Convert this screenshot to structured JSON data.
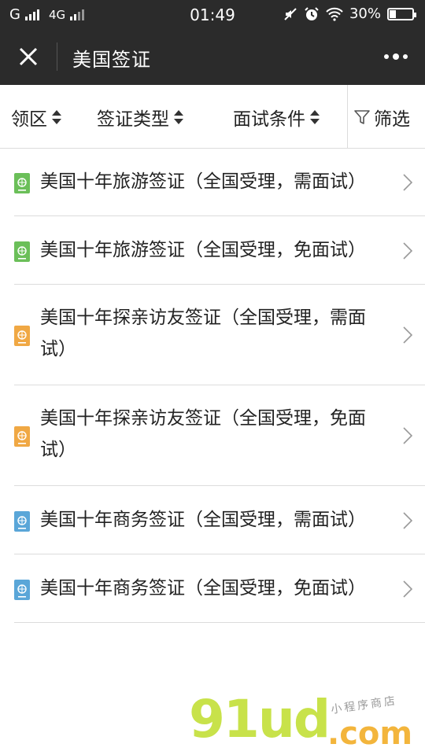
{
  "status_bar": {
    "carrier_left": "G",
    "network": "4G",
    "time": "01:49",
    "battery": "30%",
    "battery_level": 0.3
  },
  "navbar": {
    "title": "美国签证"
  },
  "filters": [
    {
      "label": "领区"
    },
    {
      "label": "签证类型"
    },
    {
      "label": "面试条件"
    },
    {
      "label": "筛选"
    }
  ],
  "items": [
    {
      "line1": "美国十年旅游签证（全国受理，需面试）",
      "line2": "",
      "icon_color": "#6bbf59"
    },
    {
      "line1": "美国十年旅游签证（全国受理，免面试）",
      "line2": "",
      "icon_color": "#6bbf59"
    },
    {
      "line1": "美国十年探亲访友签证（全国受理，需面",
      "line2": "试）",
      "icon_color": "#f0a844"
    },
    {
      "line1": "美国十年探亲访友签证（全国受理，免面",
      "line2": "试）",
      "icon_color": "#f0a844"
    },
    {
      "line1": "美国十年商务签证（全国受理，需面试）",
      "line2": "",
      "icon_color": "#5aa6d8"
    },
    {
      "line1": "美国十年商务签证（全国受理，免面试）",
      "line2": "",
      "icon_color": "#5aa6d8"
    }
  ],
  "watermark": {
    "main": "91ud",
    "dotcom": ".com",
    "sub": "小程序商店"
  }
}
